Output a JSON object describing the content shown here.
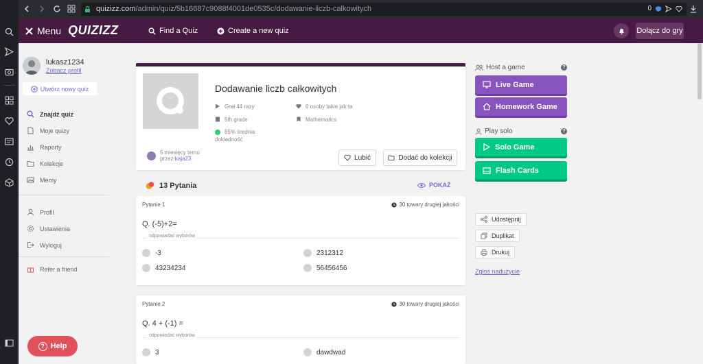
{
  "browser": {
    "url_host": "quizizz.com",
    "url_path": "/admin/quiz/5b16687c9088f4001de0535c/dodawanie-liczb-calkowitych",
    "ext_badge": "0"
  },
  "header": {
    "menu_label": "Menu",
    "logo": "QUIZIZZ",
    "find_quiz": "Find a Quiz",
    "create_quiz": "Create a new quiz",
    "join": "Dołącz do gry"
  },
  "sidebar": {
    "username": "lukasz1234",
    "profile_link": "Zobacz profil",
    "create_button": "Utwórz nowy quiz",
    "items": [
      {
        "label": "Znajdź quiz"
      },
      {
        "label": "Moje quizy"
      },
      {
        "label": "Raporty"
      },
      {
        "label": "Kolekcje"
      },
      {
        "label": "Memy"
      },
      {
        "label": "Profil"
      },
      {
        "label": "Ustawienia"
      },
      {
        "label": "Wyloguj"
      },
      {
        "label": "Refer a friend"
      }
    ],
    "help": "Help"
  },
  "quiz": {
    "title": "Dodawanie liczb całkowitych",
    "played": "Grał 44 razy",
    "likes": "0 osoby takie jak ta",
    "grade": "5th grade",
    "subject": "Mathematics",
    "accuracy_line1": "85% średnia",
    "accuracy_line2": "dokładność",
    "author_time": "5 miesięcy temu",
    "author_by": "przez",
    "author_name": "kaja23",
    "like_button": "Lubić",
    "collection_button": "Dodać do kolekcji"
  },
  "questions_header": {
    "count": "13 Pytania",
    "show": "POKAŻ"
  },
  "questions": [
    {
      "label": "Pytanie 1",
      "time": "30 towary drugiej jakości",
      "text": "Q.  (-5)+2=",
      "options_label": "odpowiadać wyborów",
      "options": [
        "-3",
        "2312312",
        "43234234",
        "56456456"
      ]
    },
    {
      "label": "Pytanie 2",
      "time": "30 towary drugiej jakości",
      "text": "Q.  4 + (-1) =",
      "options_label": "odpowiadać wyborów",
      "options": [
        "3",
        "dawdwad"
      ]
    }
  ],
  "right": {
    "host_title": "Host a game",
    "live_game": "Live Game",
    "homework_game": "Homework Game",
    "solo_title": "Play solo",
    "solo_game": "Solo Game",
    "flash_cards": "Flash Cards",
    "share": "Udostępnij",
    "duplicate": "Duplikat",
    "print": "Drukuj",
    "report": "Zgłoś nadużycie"
  },
  "colors": {
    "brand": "#461a42",
    "purple_button": "#8854c0",
    "green_button": "#00c985",
    "help": "#e0505d"
  }
}
